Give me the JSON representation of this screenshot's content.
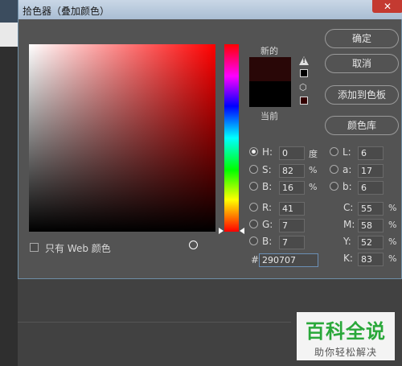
{
  "dialog": {
    "title": "拾色器（叠加颜色）",
    "close_glyph": "✕"
  },
  "preview": {
    "new_label": "新的",
    "current_label": "当前",
    "new_color": "#290707",
    "current_color": "#000000"
  },
  "buttons": {
    "ok": "确定",
    "cancel": "取消",
    "add_to_swatches": "添加到色板",
    "color_libraries": "颜色库"
  },
  "hsb": {
    "h_label": "H:",
    "h_value": "0",
    "h_unit": "度",
    "s_label": "S:",
    "s_value": "82",
    "s_unit": "%",
    "b_label": "B:",
    "b_value": "16",
    "b_unit": "%",
    "selected": "H"
  },
  "rgb": {
    "r_label": "R:",
    "r_value": "41",
    "g_label": "G:",
    "g_value": "7",
    "b_label": "B:",
    "b_value": "7"
  },
  "lab": {
    "l_label": "L:",
    "l_value": "6",
    "a_label": "a:",
    "a_value": "17",
    "b_label": "b:",
    "b_value": "6"
  },
  "cmyk": {
    "c_label": "C:",
    "c_value": "55",
    "c_unit": "%",
    "m_label": "M:",
    "m_value": "58",
    "m_unit": "%",
    "y_label": "Y:",
    "y_value": "52",
    "y_unit": "%",
    "k_label": "K:",
    "k_value": "83",
    "k_unit": "%"
  },
  "hex": {
    "label": "#",
    "value": "290707"
  },
  "web_only": {
    "label": "只有 Web 颜色",
    "checked": false
  },
  "watermark": {
    "main": "百科全说",
    "sub": "助你轻松解决"
  }
}
